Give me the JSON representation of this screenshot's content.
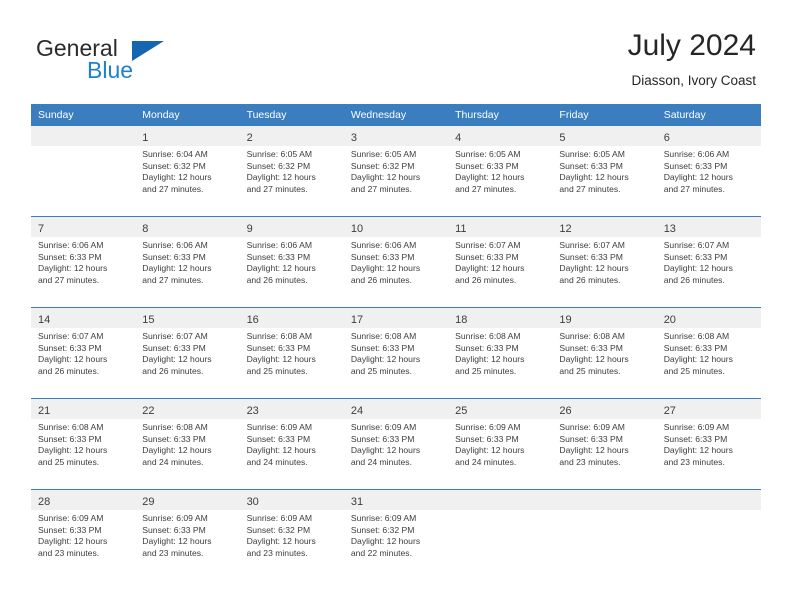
{
  "brand": {
    "name_top": "General",
    "name_bottom": "Blue",
    "triangle_color": "#1565b0",
    "blue_color": "#1f7fd0"
  },
  "header": {
    "title": "July 2024",
    "subtitle": "Diasson, Ivory Coast"
  },
  "theme": {
    "header_blue": "#3a7ebf",
    "band_gray": "#f0f0f0",
    "text": "#3d3d3d"
  },
  "weekday_headers": [
    "Sunday",
    "Monday",
    "Tuesday",
    "Wednesday",
    "Thursday",
    "Friday",
    "Saturday"
  ],
  "weeks": [
    {
      "days": [
        {
          "num": "",
          "empty": true,
          "sunrise": "",
          "sunset": "",
          "daylight_line1": "",
          "daylight_line2": ""
        },
        {
          "num": "1",
          "sunrise": "Sunrise: 6:04 AM",
          "sunset": "Sunset: 6:32 PM",
          "daylight_line1": "Daylight: 12 hours",
          "daylight_line2": "and 27 minutes."
        },
        {
          "num": "2",
          "sunrise": "Sunrise: 6:05 AM",
          "sunset": "Sunset: 6:32 PM",
          "daylight_line1": "Daylight: 12 hours",
          "daylight_line2": "and 27 minutes."
        },
        {
          "num": "3",
          "sunrise": "Sunrise: 6:05 AM",
          "sunset": "Sunset: 6:32 PM",
          "daylight_line1": "Daylight: 12 hours",
          "daylight_line2": "and 27 minutes."
        },
        {
          "num": "4",
          "sunrise": "Sunrise: 6:05 AM",
          "sunset": "Sunset: 6:33 PM",
          "daylight_line1": "Daylight: 12 hours",
          "daylight_line2": "and 27 minutes."
        },
        {
          "num": "5",
          "sunrise": "Sunrise: 6:05 AM",
          "sunset": "Sunset: 6:33 PM",
          "daylight_line1": "Daylight: 12 hours",
          "daylight_line2": "and 27 minutes."
        },
        {
          "num": "6",
          "sunrise": "Sunrise: 6:06 AM",
          "sunset": "Sunset: 6:33 PM",
          "daylight_line1": "Daylight: 12 hours",
          "daylight_line2": "and 27 minutes."
        }
      ]
    },
    {
      "days": [
        {
          "num": "7",
          "sunrise": "Sunrise: 6:06 AM",
          "sunset": "Sunset: 6:33 PM",
          "daylight_line1": "Daylight: 12 hours",
          "daylight_line2": "and 27 minutes."
        },
        {
          "num": "8",
          "sunrise": "Sunrise: 6:06 AM",
          "sunset": "Sunset: 6:33 PM",
          "daylight_line1": "Daylight: 12 hours",
          "daylight_line2": "and 27 minutes."
        },
        {
          "num": "9",
          "sunrise": "Sunrise: 6:06 AM",
          "sunset": "Sunset: 6:33 PM",
          "daylight_line1": "Daylight: 12 hours",
          "daylight_line2": "and 26 minutes."
        },
        {
          "num": "10",
          "sunrise": "Sunrise: 6:06 AM",
          "sunset": "Sunset: 6:33 PM",
          "daylight_line1": "Daylight: 12 hours",
          "daylight_line2": "and 26 minutes."
        },
        {
          "num": "11",
          "sunrise": "Sunrise: 6:07 AM",
          "sunset": "Sunset: 6:33 PM",
          "daylight_line1": "Daylight: 12 hours",
          "daylight_line2": "and 26 minutes."
        },
        {
          "num": "12",
          "sunrise": "Sunrise: 6:07 AM",
          "sunset": "Sunset: 6:33 PM",
          "daylight_line1": "Daylight: 12 hours",
          "daylight_line2": "and 26 minutes."
        },
        {
          "num": "13",
          "sunrise": "Sunrise: 6:07 AM",
          "sunset": "Sunset: 6:33 PM",
          "daylight_line1": "Daylight: 12 hours",
          "daylight_line2": "and 26 minutes."
        }
      ]
    },
    {
      "days": [
        {
          "num": "14",
          "sunrise": "Sunrise: 6:07 AM",
          "sunset": "Sunset: 6:33 PM",
          "daylight_line1": "Daylight: 12 hours",
          "daylight_line2": "and 26 minutes."
        },
        {
          "num": "15",
          "sunrise": "Sunrise: 6:07 AM",
          "sunset": "Sunset: 6:33 PM",
          "daylight_line1": "Daylight: 12 hours",
          "daylight_line2": "and 26 minutes."
        },
        {
          "num": "16",
          "sunrise": "Sunrise: 6:08 AM",
          "sunset": "Sunset: 6:33 PM",
          "daylight_line1": "Daylight: 12 hours",
          "daylight_line2": "and 25 minutes."
        },
        {
          "num": "17",
          "sunrise": "Sunrise: 6:08 AM",
          "sunset": "Sunset: 6:33 PM",
          "daylight_line1": "Daylight: 12 hours",
          "daylight_line2": "and 25 minutes."
        },
        {
          "num": "18",
          "sunrise": "Sunrise: 6:08 AM",
          "sunset": "Sunset: 6:33 PM",
          "daylight_line1": "Daylight: 12 hours",
          "daylight_line2": "and 25 minutes."
        },
        {
          "num": "19",
          "sunrise": "Sunrise: 6:08 AM",
          "sunset": "Sunset: 6:33 PM",
          "daylight_line1": "Daylight: 12 hours",
          "daylight_line2": "and 25 minutes."
        },
        {
          "num": "20",
          "sunrise": "Sunrise: 6:08 AM",
          "sunset": "Sunset: 6:33 PM",
          "daylight_line1": "Daylight: 12 hours",
          "daylight_line2": "and 25 minutes."
        }
      ]
    },
    {
      "days": [
        {
          "num": "21",
          "sunrise": "Sunrise: 6:08 AM",
          "sunset": "Sunset: 6:33 PM",
          "daylight_line1": "Daylight: 12 hours",
          "daylight_line2": "and 25 minutes."
        },
        {
          "num": "22",
          "sunrise": "Sunrise: 6:08 AM",
          "sunset": "Sunset: 6:33 PM",
          "daylight_line1": "Daylight: 12 hours",
          "daylight_line2": "and 24 minutes."
        },
        {
          "num": "23",
          "sunrise": "Sunrise: 6:09 AM",
          "sunset": "Sunset: 6:33 PM",
          "daylight_line1": "Daylight: 12 hours",
          "daylight_line2": "and 24 minutes."
        },
        {
          "num": "24",
          "sunrise": "Sunrise: 6:09 AM",
          "sunset": "Sunset: 6:33 PM",
          "daylight_line1": "Daylight: 12 hours",
          "daylight_line2": "and 24 minutes."
        },
        {
          "num": "25",
          "sunrise": "Sunrise: 6:09 AM",
          "sunset": "Sunset: 6:33 PM",
          "daylight_line1": "Daylight: 12 hours",
          "daylight_line2": "and 24 minutes."
        },
        {
          "num": "26",
          "sunrise": "Sunrise: 6:09 AM",
          "sunset": "Sunset: 6:33 PM",
          "daylight_line1": "Daylight: 12 hours",
          "daylight_line2": "and 23 minutes."
        },
        {
          "num": "27",
          "sunrise": "Sunrise: 6:09 AM",
          "sunset": "Sunset: 6:33 PM",
          "daylight_line1": "Daylight: 12 hours",
          "daylight_line2": "and 23 minutes."
        }
      ]
    },
    {
      "days": [
        {
          "num": "28",
          "sunrise": "Sunrise: 6:09 AM",
          "sunset": "Sunset: 6:33 PM",
          "daylight_line1": "Daylight: 12 hours",
          "daylight_line2": "and 23 minutes."
        },
        {
          "num": "29",
          "sunrise": "Sunrise: 6:09 AM",
          "sunset": "Sunset: 6:33 PM",
          "daylight_line1": "Daylight: 12 hours",
          "daylight_line2": "and 23 minutes."
        },
        {
          "num": "30",
          "sunrise": "Sunrise: 6:09 AM",
          "sunset": "Sunset: 6:32 PM",
          "daylight_line1": "Daylight: 12 hours",
          "daylight_line2": "and 23 minutes."
        },
        {
          "num": "31",
          "sunrise": "Sunrise: 6:09 AM",
          "sunset": "Sunset: 6:32 PM",
          "daylight_line1": "Daylight: 12 hours",
          "daylight_line2": "and 22 minutes."
        },
        {
          "num": "",
          "empty": true,
          "sunrise": "",
          "sunset": "",
          "daylight_line1": "",
          "daylight_line2": ""
        },
        {
          "num": "",
          "empty": true,
          "sunrise": "",
          "sunset": "",
          "daylight_line1": "",
          "daylight_line2": ""
        },
        {
          "num": "",
          "empty": true,
          "sunrise": "",
          "sunset": "",
          "daylight_line1": "",
          "daylight_line2": ""
        }
      ]
    }
  ]
}
